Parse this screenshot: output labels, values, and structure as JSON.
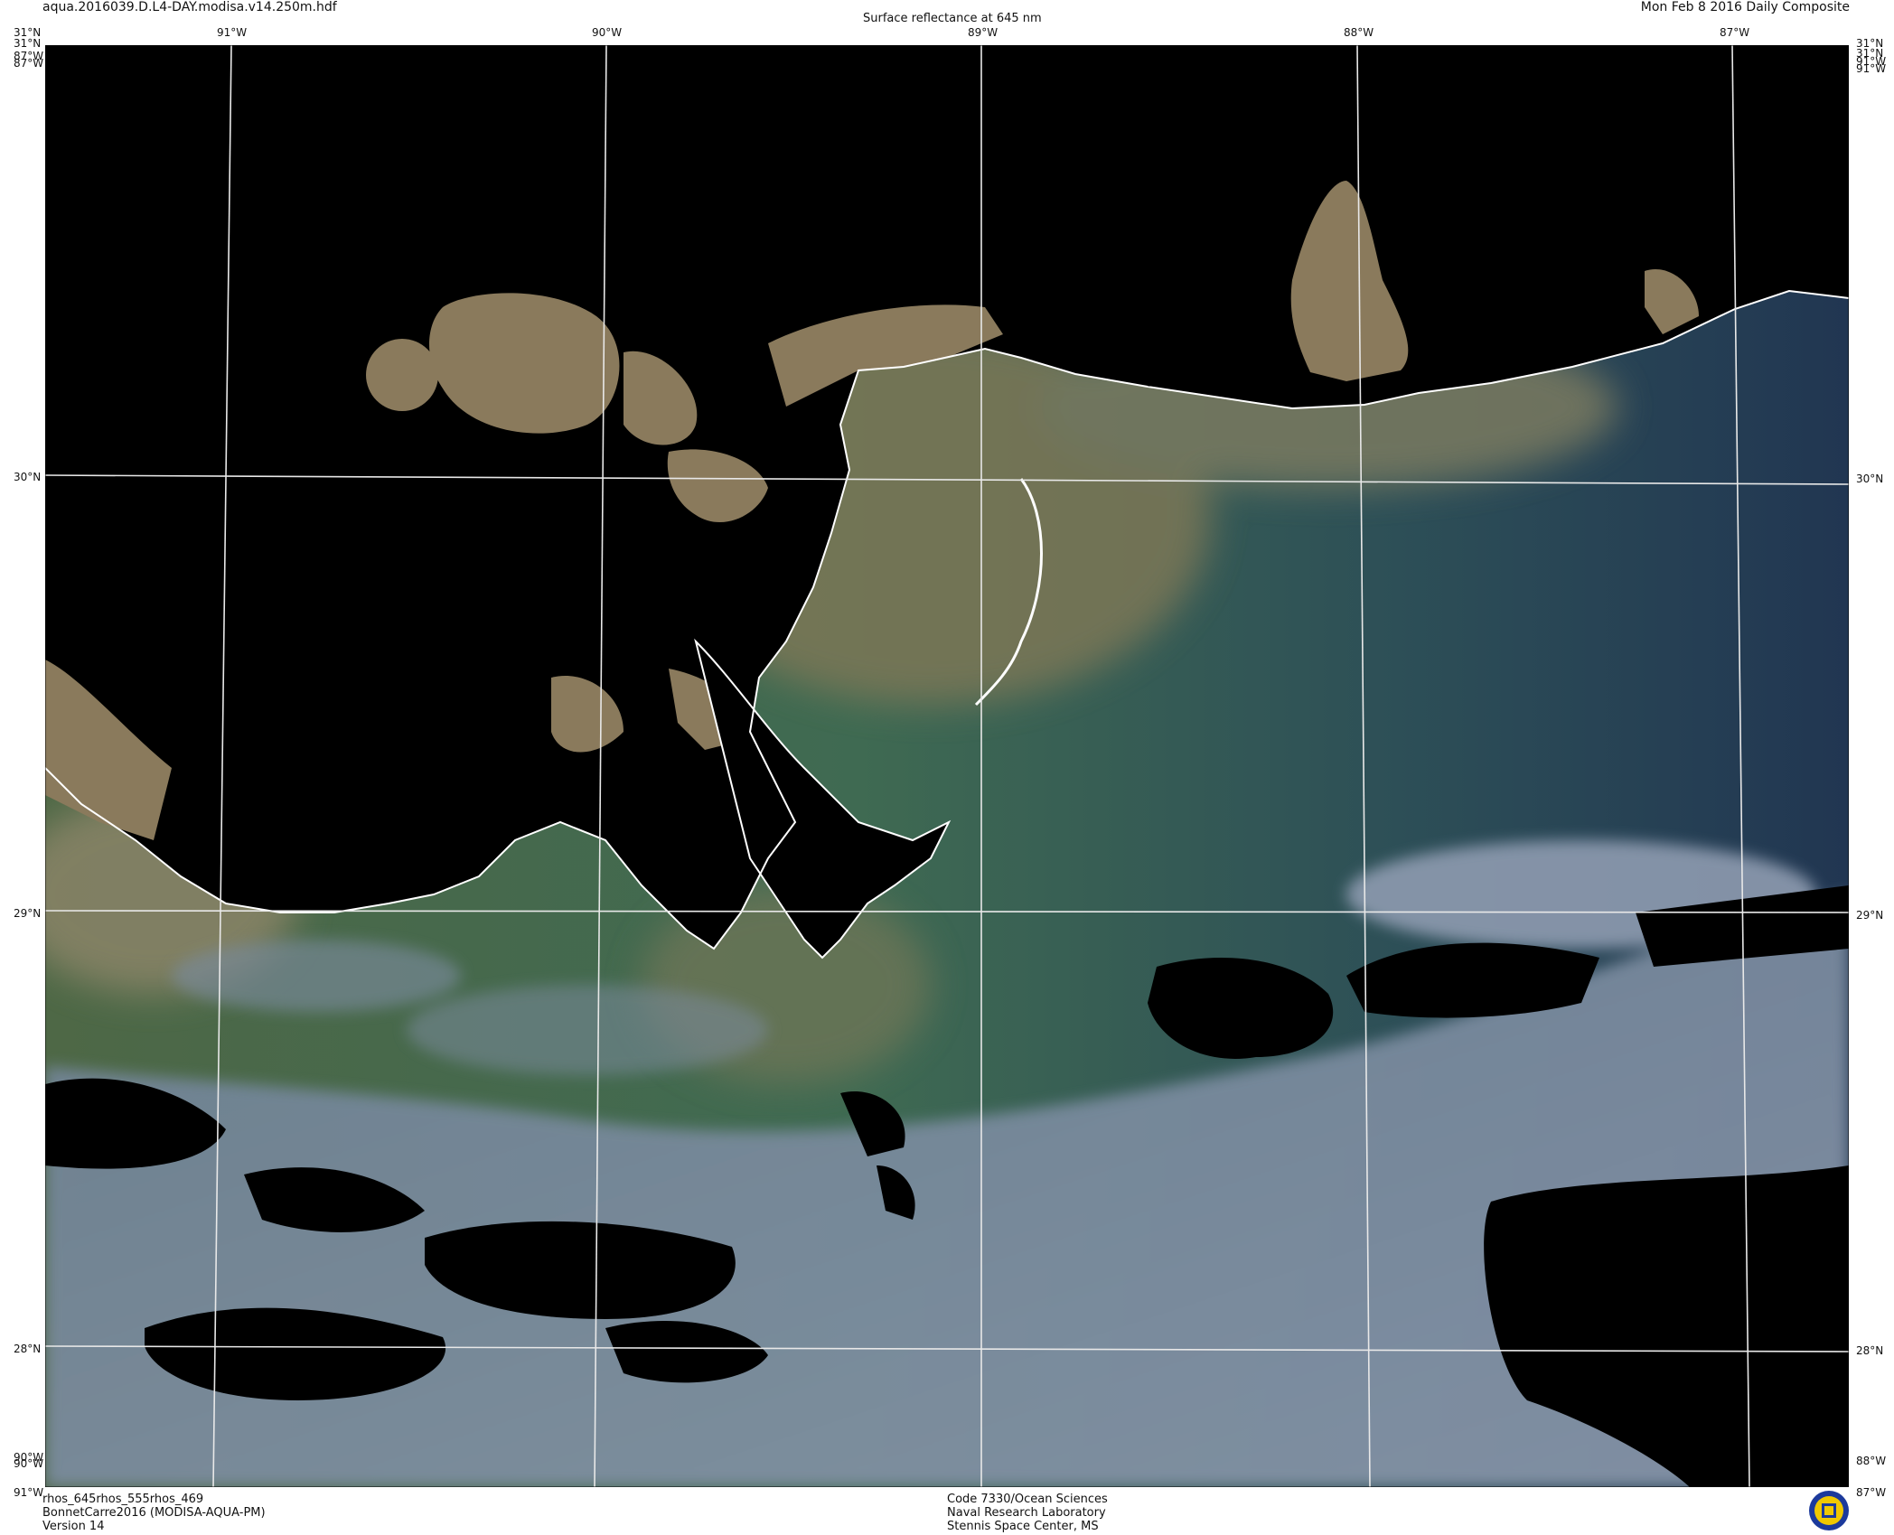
{
  "header": {
    "filename": "aqua.2016039.D.L4-DAY.modisa.v14.250m.hdf",
    "title": "Surface reflectance at 645 nm",
    "date": "Mon Feb  8 2016 Daily Composite"
  },
  "axes": {
    "top": [
      "91°W",
      "90°W",
      "89°W",
      "88°W",
      "87°W"
    ],
    "bottom": [
      "91°W",
      "87°W"
    ],
    "left": [
      "31°N",
      "30°N",
      "29°N",
      "28°N"
    ],
    "right": [
      "31°N",
      "30°N",
      "29°N",
      "28°N"
    ],
    "corner_tl": "31°N",
    "corner_tl_under": "87°W",
    "corner_bl_lon": "90°W",
    "corner_tr": "31°N",
    "corner_tr_under": "91°W",
    "corner_br_lon": "88°W"
  },
  "footer": {
    "left": [
      "rhos_645rhos_555rhos_469",
      "BonnetCarre2016 (MODISA-AQUA-PM)",
      "Version 14"
    ],
    "center": [
      "Code 7330/Ocean Sciences",
      "Naval Research Laboratory",
      "Stennis Space Center, MS"
    ]
  },
  "colors": {
    "land_mask": "#000000",
    "sediment": "#8a7a5c",
    "shelf_water": "#4a6848",
    "open_water": "#253b55",
    "cloud": "#a8b4c8",
    "grid": "#ffffff",
    "logo_ring": "#1c3a9c",
    "logo_fill": "#f0c800"
  },
  "logo": {
    "name": "naval-research-laboratory-seal"
  }
}
